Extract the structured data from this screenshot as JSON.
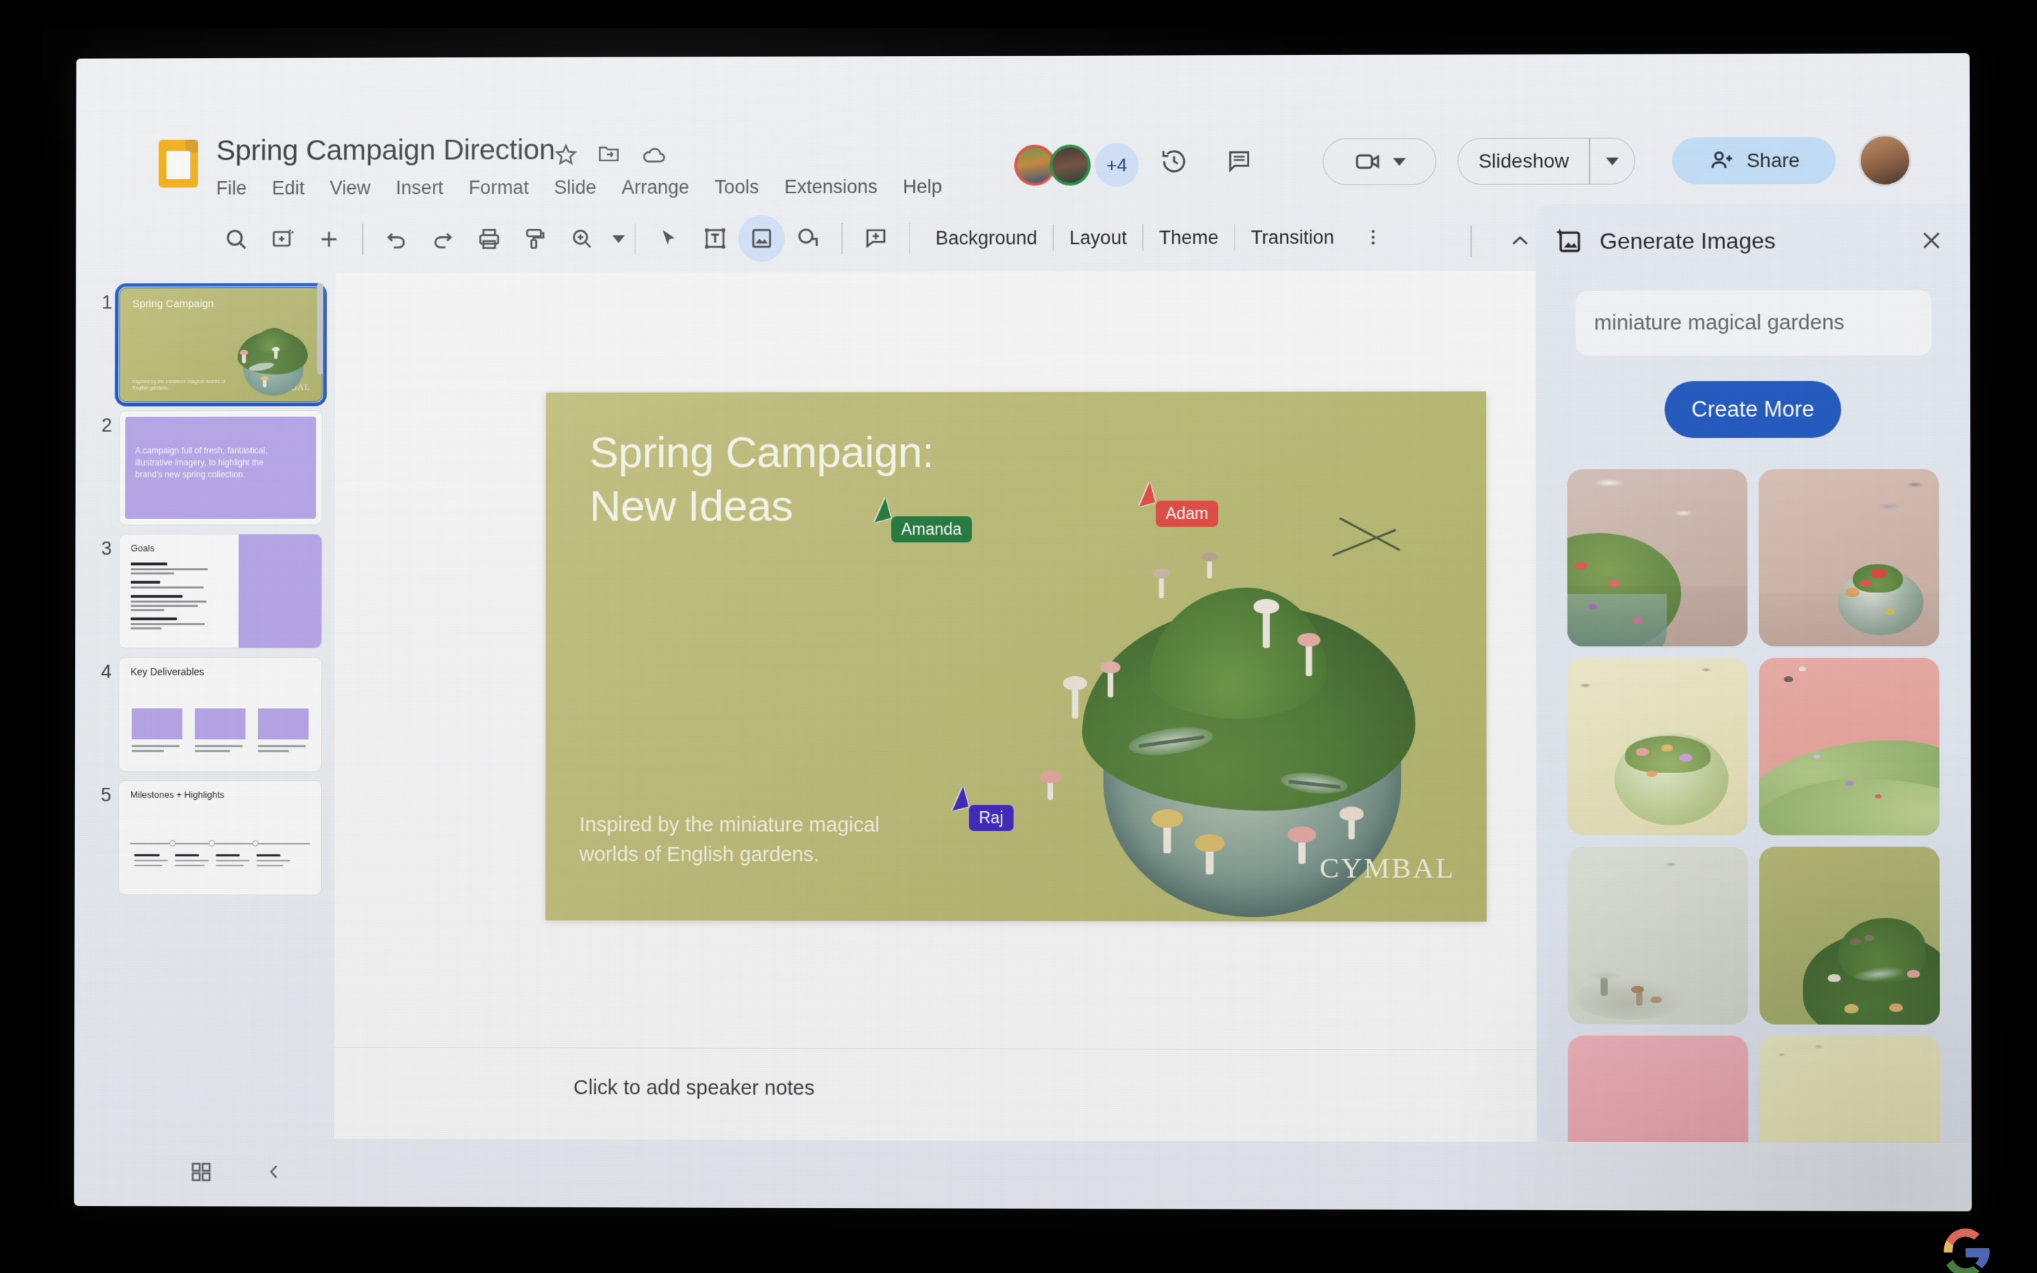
{
  "app": {
    "doc_title": "Spring Campaign Direction",
    "doc_icon": "slides-icon",
    "title_actions": [
      {
        "name": "star-icon",
        "label": "Star"
      },
      {
        "name": "move-to-folder-icon",
        "label": "Move"
      },
      {
        "name": "cloud-saved-icon",
        "label": "Saved to Drive"
      }
    ],
    "menus": [
      "File",
      "Edit",
      "View",
      "Insert",
      "Format",
      "Slide",
      "Arrange",
      "Tools",
      "Extensions",
      "Help"
    ],
    "collaborators_overflow": "+4",
    "history_icon": "version-history-icon",
    "comment_icon": "comment-icon",
    "meet_icon": "video-camera-icon",
    "slideshow_label": "Slideshow",
    "share_label": "Share",
    "share_icon": "people-add-icon"
  },
  "toolbar": {
    "icons": [
      {
        "name": "search-icon"
      },
      {
        "name": "new-slide-icon"
      },
      {
        "name": "add-icon"
      },
      {
        "name": "undo-icon"
      },
      {
        "name": "redo-icon"
      },
      {
        "name": "print-icon"
      },
      {
        "name": "paint-format-icon"
      },
      {
        "name": "zoom-icon"
      }
    ],
    "tools": [
      {
        "name": "select-tool-icon",
        "selected": false
      },
      {
        "name": "text-box-icon",
        "selected": false
      },
      {
        "name": "insert-image-icon",
        "selected": true
      },
      {
        "name": "shape-icon",
        "selected": false
      },
      {
        "name": "add-comment-icon",
        "selected": false
      }
    ],
    "buttons": [
      "Background",
      "Layout",
      "Theme",
      "Transition"
    ],
    "more_icon": "more-vertical-icon",
    "collapse_icon": "chevron-up-icon"
  },
  "filmstrip": {
    "slides": [
      {
        "number": "1",
        "title": "Spring Campaign",
        "caption": "Inspired by the miniature magical worlds of English gardens.",
        "brand": "CYMBAL",
        "active": true
      },
      {
        "number": "2",
        "body": "A campaign full of fresh, fantastical, illustrative imagery, to highlight the brand's new spring collection.",
        "active": false
      },
      {
        "number": "3",
        "title": "Goals",
        "active": false
      },
      {
        "number": "4",
        "title": "Key Deliverables",
        "active": false
      },
      {
        "number": "5",
        "title": "Milestones + Highlights",
        "active": false
      }
    ]
  },
  "slide": {
    "headline_line1": "Spring Campaign:",
    "headline_line2": "New Ideas",
    "caption_line1": "Inspired by the miniature magical",
    "caption_line2": "worlds of English gardens.",
    "brand": "CYMBAL",
    "background_color": "#bfbe76"
  },
  "cursors": [
    {
      "name": "Amanda",
      "color": "#1e7a3a"
    },
    {
      "name": "Adam",
      "color": "#e8483f"
    },
    {
      "name": "Raj",
      "color": "#3f25c4"
    }
  ],
  "notes": {
    "placeholder": "Click to add speaker notes"
  },
  "bottom_bar": {
    "grid_view_icon": "grid-view-icon",
    "expand_icon": "chevron-left-icon"
  },
  "panel": {
    "title": "Generate Images",
    "title_icon": "generate-image-icon",
    "close_icon": "close-icon",
    "prompt_value": "miniature magical gardens",
    "create_label": "Create More",
    "results": [
      {
        "id": "1",
        "alt": "moss bowl with red mushrooms and dragonflies on taupe background"
      },
      {
        "id": "2",
        "alt": "glass sphere terrarium with mushrooms on beige background"
      },
      {
        "id": "3",
        "alt": "glass bowl garden with pastel flowers on cream background"
      },
      {
        "id": "4",
        "alt": "rolling mossy hills with tiny mushrooms on pink background"
      },
      {
        "id": "5",
        "alt": "pale misty scene with small mushrooms and grasses"
      },
      {
        "id": "6",
        "alt": "mossy mound with dragonfly and mushrooms on olive background"
      },
      {
        "id": "7",
        "alt": "pink dunes with moss tufts"
      },
      {
        "id": "8",
        "alt": "pale yellow field with small red flowers"
      }
    ]
  },
  "watermark": {
    "logo": "google-logo"
  }
}
